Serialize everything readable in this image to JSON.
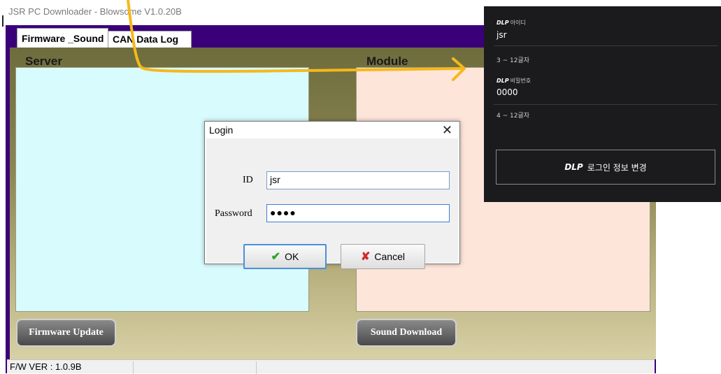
{
  "window": {
    "title": "JSR PC Downloader - Blowsome V1.0.20B"
  },
  "tabs": [
    {
      "label": "Firmware _Sound",
      "active": true
    },
    {
      "label": "CAN Data Log",
      "active": false
    }
  ],
  "main": {
    "server_label": "Server",
    "module_label": "Module",
    "firmware_update_button": "Firmware Update",
    "sound_download_button": "Sound Download"
  },
  "statusbar": {
    "fw_version": "F/W VER : 1.0.9B"
  },
  "login_dialog": {
    "title": "Login",
    "close_glyph": "✕",
    "id_label": "ID",
    "id_value": "jsr",
    "password_label": "Password",
    "password_masked": "●●●●",
    "ok_label": "OK",
    "cancel_label": "Cancel"
  },
  "dark_panel": {
    "brand": "DLP",
    "id_field_label": "아이디",
    "id_value": "jsr",
    "id_hint": "3 ~ 12글자",
    "password_field_label": "비밀번호",
    "password_value": "0000",
    "password_hint": "4 ~ 12글자",
    "change_button_label": "로그인 정보 변경"
  },
  "colors": {
    "frame_purple": "#3a007a",
    "server_bg": "#d8fbfd",
    "module_bg": "#fde5da",
    "arrow_yellow": "#f5b81c",
    "dark_panel_bg": "#1b1b1d"
  }
}
